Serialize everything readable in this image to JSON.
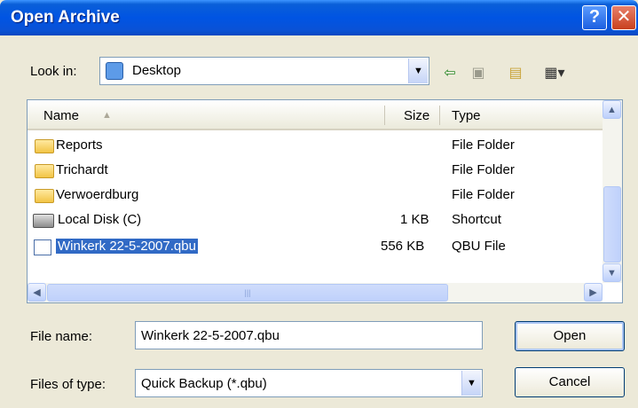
{
  "window": {
    "title": "Open Archive"
  },
  "titlebar": {
    "help_label": "?",
    "close_label": "✕"
  },
  "lookin": {
    "label": "Look in:",
    "value": "Desktop"
  },
  "toolbar": {
    "back_icon": "back-arrow-icon",
    "up_icon": "up-folder-icon",
    "new_folder_icon": "new-folder-icon",
    "views_icon": "views-menu-icon"
  },
  "list": {
    "columns": {
      "name": "Name",
      "size": "Size",
      "type": "Type"
    },
    "rows": [
      {
        "name": "Reports",
        "size": "",
        "type": "File Folder",
        "icon": "folder-icon"
      },
      {
        "name": "Trichardt",
        "size": "",
        "type": "File Folder",
        "icon": "folder-icon"
      },
      {
        "name": "Verwoerdburg",
        "size": "",
        "type": "File Folder",
        "icon": "folder-icon"
      },
      {
        "name": "Local Disk (C)",
        "size": "1 KB",
        "type": "Shortcut",
        "icon": "disk-shortcut-icon"
      },
      {
        "name": "Winkerk 22-5-2007.qbu",
        "size": "556 KB",
        "type": "QBU File",
        "icon": "file-icon",
        "selected": true
      }
    ]
  },
  "filename": {
    "label": "File name:",
    "value": "Winkerk 22-5-2007.qbu"
  },
  "filetype": {
    "label": "Files of type:",
    "value": "Quick Backup (*.qbu)"
  },
  "buttons": {
    "open": "Open",
    "cancel": "Cancel"
  },
  "colors": {
    "selection": "#316ac5",
    "titlebar": "#0054e3",
    "dialog_bg": "#ece9d8"
  }
}
